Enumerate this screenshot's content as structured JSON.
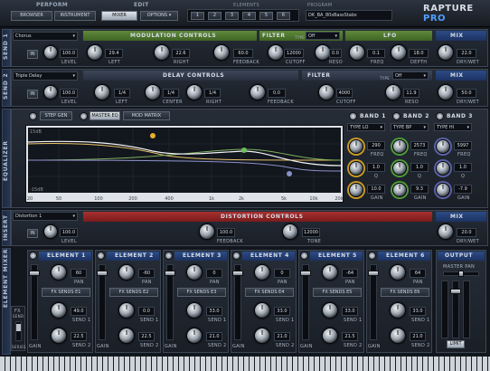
{
  "top": {
    "perform_label": "PERFORM",
    "edit_label": "EDIT",
    "browser_btn": "BROWSER",
    "instrument_btn": "INSTRUMENT",
    "mixer_btn": "MIXER",
    "options_btn": "OPTIONS",
    "elements_label": "ELEMENTS",
    "element_nums": [
      "1",
      "2",
      "3",
      "4",
      "5",
      "6"
    ],
    "program_label": "PROGRAM",
    "program_name": "DK_BA_80sBassStabs",
    "logo_main": "RAPTURE",
    "logo_accent": "PRO"
  },
  "send1": {
    "side_label": "SEND 1",
    "fx_name": "Chorus",
    "in_label": "IN",
    "level_value": "100.0",
    "level_label": "LEVEL",
    "mod_title": "MODULATION CONTROLS",
    "left_value": "29.4",
    "left_label": "LEFT",
    "right_value": "22.6",
    "right_label": "RIGHT",
    "feedback_value": "60.0",
    "feedback_label": "FEEDBACK",
    "filter_title": "FILTER",
    "filter_type_label": "TYPE",
    "filter_type": "Off",
    "cutoff_value": "12000",
    "cutoff_label": "CUTOFF",
    "reso_value": "0.0",
    "reso_label": "RESO",
    "lfo_title": "LFO",
    "freq_value": "0.1",
    "freq_label": "FREQ",
    "depth_value": "18.0",
    "depth_label": "DEPTH",
    "mix_title": "MIX",
    "drywet_value": "22.0",
    "drywet_label": "DRY/WET"
  },
  "send2": {
    "side_label": "SEND 2",
    "fx_name": "Triple Delay",
    "in_label": "IN",
    "level_value": "100.0",
    "level_label": "LEVEL",
    "delay_title": "DELAY CONTROLS",
    "left_value": "1/4",
    "left_label": "LEFT",
    "center_value": "1/4",
    "center_label": "CENTER",
    "right_value": "1/4",
    "right_label": "RIGHT",
    "feedback_value": "0.0",
    "feedback_label": "FEEDBACK",
    "filter_title": "FILTER",
    "filter_type_label": "TYPE",
    "filter_type": "Off",
    "cutoff_value": "4000",
    "cutoff_label": "CUTOFF",
    "reso_value": "11.9",
    "reso_label": "RESO",
    "mix_title": "MIX",
    "drywet_value": "50.0",
    "drywet_label": "DRY/WET"
  },
  "eq": {
    "side_label": "EQUALIZER",
    "step_gen": "STEP GEN",
    "master_eq": "MASTER EQ",
    "mod_matrix": "MOD MATRIX",
    "db_top": "15dB",
    "db_bottom": "-15dB",
    "freq_ticks": [
      "20",
      "50",
      "100",
      "200",
      "400",
      "1k",
      "2k",
      "5k",
      "10k",
      "20k"
    ],
    "bands": [
      {
        "title": "BAND 1",
        "type": "LO",
        "freq": "290",
        "freq_label": "FREQ",
        "q": "1.0",
        "q_label": "Q",
        "gain": "10.0",
        "gain_label": "GAIN",
        "color": "#e8b030"
      },
      {
        "title": "BAND 2",
        "type": "BP",
        "freq": "2573",
        "freq_label": "FREQ",
        "q": "1.0",
        "q_label": "Q",
        "gain": "9.3",
        "gain_label": "GAIN",
        "color": "#6fbf5a"
      },
      {
        "title": "BAND 3",
        "type": "HI",
        "freq": "5997",
        "freq_label": "FREQ",
        "q": "1.0",
        "q_label": "Q",
        "gain": "-7.9",
        "gain_label": "GAIN",
        "color": "#8a90c8"
      }
    ]
  },
  "insert": {
    "side_label": "INSERT",
    "fx_name": "Distortion 1",
    "in_label": "IN",
    "level_value": "100.0",
    "level_label": "LEVEL",
    "dist_title": "DISTORTION CONTROLS",
    "feedback_value": "100.0",
    "feedback_label": "FEEDBACK",
    "tone_value": "12000",
    "tone_label": "TONE",
    "mix_title": "MIX",
    "drywet_value": "20.0",
    "drywet_label": "DRY/WET"
  },
  "mixer": {
    "side_label": "ELEMENT MIXER",
    "fx_label": "FX",
    "send_label": "SEND",
    "series_label": "SERIES",
    "elements": [
      {
        "title": "ELEMENT 1",
        "pan": "60",
        "fx_sends": "FX SENDS E1",
        "send1": "49.0",
        "send2": "22.5"
      },
      {
        "title": "ELEMENT 2",
        "pan": "-60",
        "fx_sends": "FX SENDS E2",
        "send1": "0.0",
        "send2": "22.5"
      },
      {
        "title": "ELEMENT 3",
        "pan": "0",
        "fx_sends": "FX SENDS E3",
        "send1": "33.0",
        "send2": "21.0"
      },
      {
        "title": "ELEMENT 4",
        "pan": "0",
        "fx_sends": "FX SENDS E4",
        "send1": "33.0",
        "send2": "21.0"
      },
      {
        "title": "ELEMENT 5",
        "pan": "-64",
        "fx_sends": "FX SENDS E5",
        "send1": "33.0",
        "send2": "21.5"
      },
      {
        "title": "ELEMENT 6",
        "pan": "64",
        "fx_sends": "FX SENDS E6",
        "send1": "33.0",
        "send2": "21.0"
      }
    ],
    "pan_label": "PAN",
    "send1_label": "SEND 1",
    "send2_label": "SEND 2",
    "gain_label": "GAIN",
    "output_title": "OUTPUT",
    "master_pan_label": "MASTER PAN",
    "limit_label": "LIMIT"
  }
}
